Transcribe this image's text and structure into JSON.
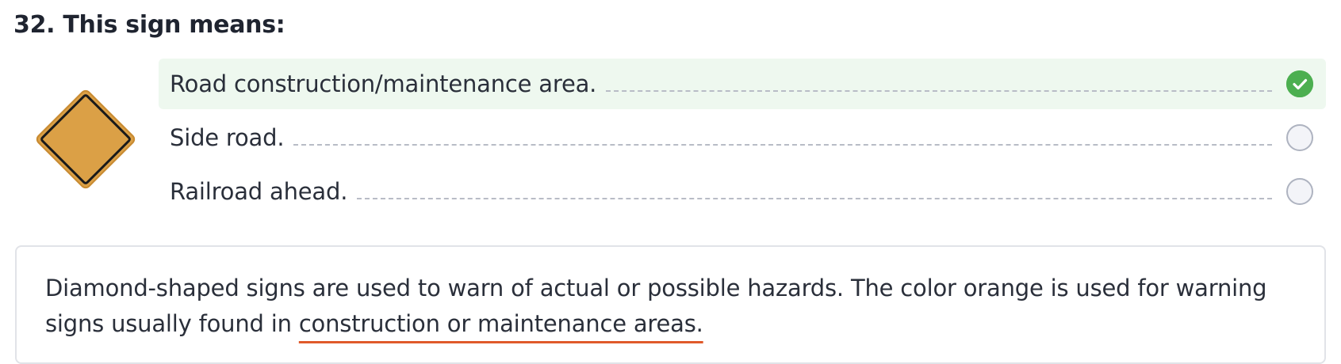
{
  "question": {
    "title": "32. This sign means:"
  },
  "sign": {
    "shape": "diamond",
    "icon": "warning-diamond-sign-icon",
    "fill_color": "#dba046",
    "border_color": "#1a1a1a"
  },
  "options": [
    {
      "label": "Road construction/maintenance area.",
      "state": "correct",
      "icon": "check-circle-icon"
    },
    {
      "label": "Side road.",
      "state": "unselected"
    },
    {
      "label": "Railroad ahead.",
      "state": "unselected"
    }
  ],
  "explanation": {
    "text_before": "Diamond-shaped signs are used to warn of actual or possible hazards. The color orange is used for warning signs usually found in ",
    "highlight": "construction or maintenance areas.",
    "highlight_color": "#e05a2b"
  },
  "colors": {
    "correct_bg": "#eef8ef",
    "correct_check": "#4caf50",
    "text": "#2a2f3a"
  }
}
